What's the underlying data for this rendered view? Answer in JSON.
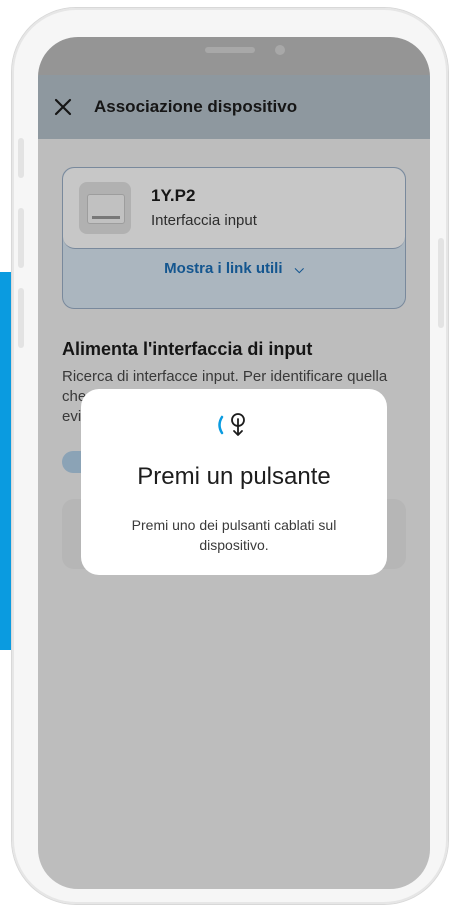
{
  "header": {
    "title": "Associazione dispositivo",
    "close_icon": "close-icon"
  },
  "device": {
    "model": "1Y.P2",
    "type": "Interfaccia input",
    "links_label": "Mostra i link utili",
    "links_icon": "chevron-down-icon"
  },
  "section": {
    "title": "Alimenta l'interfaccia di input",
    "text": "Ricerca di interfacce input. Per identificare quella che stai cercando, premi un pulsante e verrà evidenziata."
  },
  "dialog": {
    "icon": "touch-press-icon",
    "title": "Premi un pulsante",
    "text": "Premi uno dei pulsanti cablati sul dispositivo."
  },
  "colors": {
    "accent": "#0a9be0",
    "link": "#1a6fb8",
    "header_bg": "#b7c3cc"
  }
}
